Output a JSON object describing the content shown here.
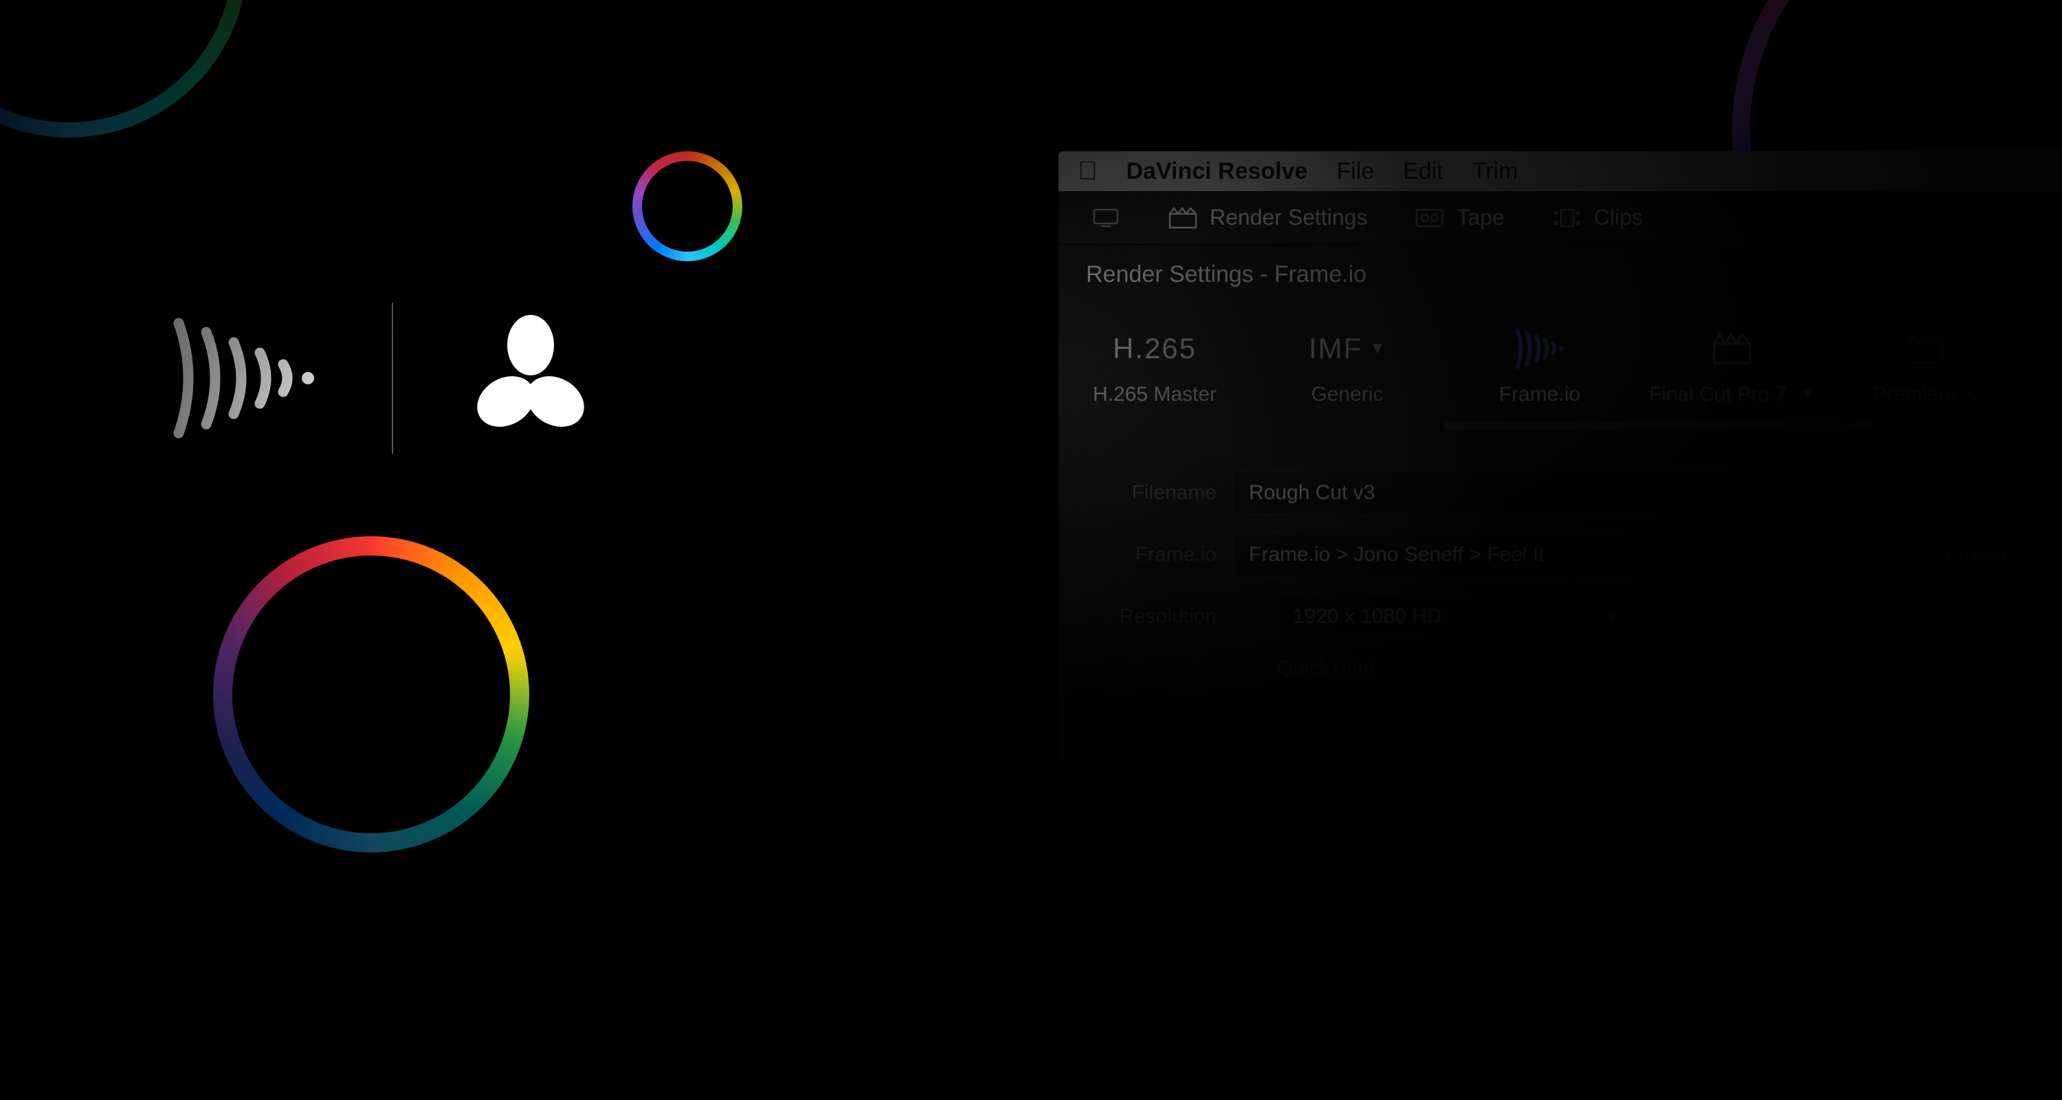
{
  "menubar": {
    "app_name": "DaVinci Resolve",
    "items": [
      "File",
      "Edit",
      "Trim"
    ]
  },
  "toolbar": {
    "render_settings": "Render Settings",
    "tape": "Tape",
    "clips": "Clips"
  },
  "panel": {
    "title": "Render Settings - Frame.io"
  },
  "presets": [
    {
      "code": "H.265",
      "label": "H.265 Master"
    },
    {
      "code": "IMF",
      "label": "Generic",
      "has_chevron": true
    },
    {
      "code": "",
      "label": "Frame.io",
      "active": true
    },
    {
      "code": "",
      "label": "Final Cut Pro 7",
      "has_chevron": true
    },
    {
      "code": "",
      "label": "Premiere X"
    }
  ],
  "form": {
    "filename_label": "Filename",
    "filename_value": "Rough Cut v3",
    "location_label": "Frame.io",
    "location_value": "Frame.io > Jono Seneff > Feel It",
    "browse_label": "Browse",
    "resolution_label": "Resolution",
    "resolution_value": "1920 x 1080 HD",
    "format_value": "QuickTime"
  }
}
